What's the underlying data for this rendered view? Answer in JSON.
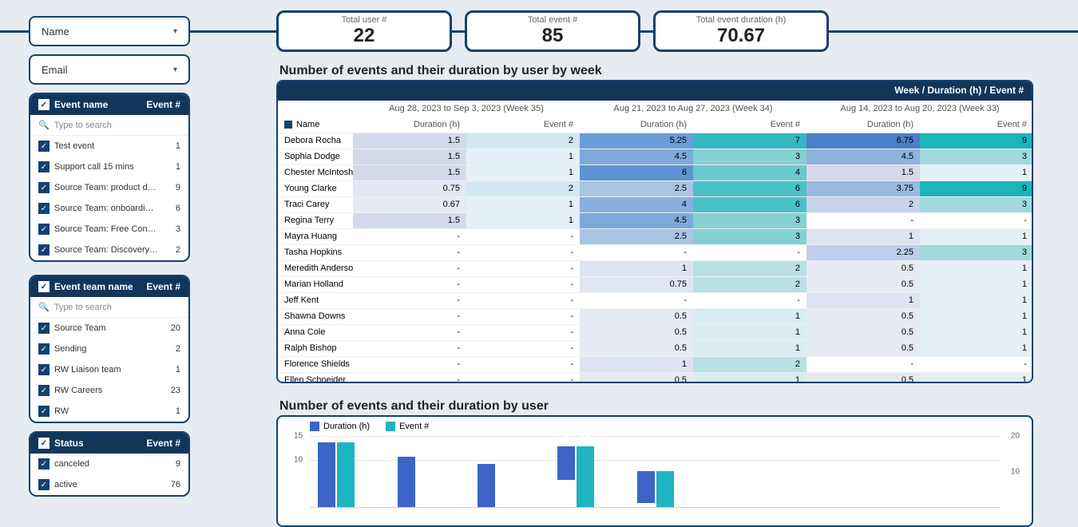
{
  "dropdowns": {
    "name": "Name",
    "email": "Email"
  },
  "kpis": [
    {
      "label": "Total user #",
      "value": "22"
    },
    {
      "label": "Total event #",
      "value": "85"
    },
    {
      "label": "Total event duration (h)",
      "value": "70.67"
    }
  ],
  "filters": {
    "eventName": {
      "title": "Event name",
      "countHeader": "Event #",
      "search": "Type to search",
      "rows": [
        {
          "label": "Test event",
          "count": "1"
        },
        {
          "label": "Support call 15 mins",
          "count": "1"
        },
        {
          "label": "Source Team: product d…",
          "count": "9"
        },
        {
          "label": "Source Team: onboardi…",
          "count": "6"
        },
        {
          "label": "Source Team: Free Cons…",
          "count": "3"
        },
        {
          "label": "Source Team: Discovery…",
          "count": "2"
        }
      ]
    },
    "eventTeam": {
      "title": "Event team name",
      "countHeader": "Event #",
      "search": "Type to search",
      "rows": [
        {
          "label": "Source Team",
          "count": "20"
        },
        {
          "label": "Sending",
          "count": "2"
        },
        {
          "label": "RW Liaison team",
          "count": "1"
        },
        {
          "label": "RW Careers",
          "count": "23"
        },
        {
          "label": "RW",
          "count": "1"
        }
      ]
    },
    "status": {
      "title": "Status",
      "countHeader": "Event #",
      "rows": [
        {
          "label": "canceled",
          "count": "9"
        },
        {
          "label": "active",
          "count": "76"
        }
      ]
    }
  },
  "tableTitle": "Number of events and their duration by user by week",
  "tableTopHeader": "Week / Duration (h) / Event #",
  "weeks": [
    "Aug 28, 2023 to Sep 3, 2023 (Week 35)",
    "Aug 21, 2023 to Aug 27, 2023 (Week 34)",
    "Aug 14, 2023 to Aug 20, 2023 (Week 33)"
  ],
  "colHeaders": {
    "name": "Name",
    "duration": "Duration (h)",
    "event": "Event #"
  },
  "rows": [
    {
      "name": "Debora Rocha",
      "cells": [
        "1.5",
        "2",
        "5.25",
        "7",
        "6.75",
        "9"
      ],
      "bg": [
        "#D4DAEB",
        "#D2E8F0",
        "#6A9DD7",
        "#33B8BF",
        "#4C7FCB",
        "#1CB5BC"
      ]
    },
    {
      "name": "Sophia Dodge",
      "cells": [
        "1.5",
        "1",
        "4.5",
        "3",
        "4.5",
        "3"
      ],
      "bg": [
        "#D4DAEB",
        "#E4F0F5",
        "#7EA8DA",
        "#84D0D3",
        "#8EB3DE",
        "#9FD9DB"
      ]
    },
    {
      "name": "Chester McIntosh",
      "cells": [
        "1.5",
        "1",
        "6",
        "4",
        "1.5",
        "1"
      ],
      "bg": [
        "#D4DAEB",
        "#E4F0F5",
        "#5F93D2",
        "#6AC8CC",
        "#D4DAEB",
        "#E4F0F5"
      ]
    },
    {
      "name": "Young Clarke",
      "cells": [
        "0.75",
        "2",
        "2.5",
        "6",
        "3.75",
        "9"
      ],
      "bg": [
        "#E3E7F2",
        "#D2E8F0",
        "#A9C4E5",
        "#4BC0C5",
        "#99BAE1",
        "#1CB5BC"
      ]
    },
    {
      "name": "Traci Carey",
      "cells": [
        "0.67",
        "1",
        "4",
        "6",
        "2",
        "3"
      ],
      "bg": [
        "#E6EAF3",
        "#E4F0F5",
        "#8AAEDD",
        "#4BC0C5",
        "#C7D3EA",
        "#9FD9DB"
      ]
    },
    {
      "name": "Regina Terry",
      "cells": [
        "1.5",
        "1",
        "4.5",
        "3",
        "-",
        "-"
      ],
      "bg": [
        "#D4DAEB",
        "#E4F0F5",
        "#7EA8DA",
        "#84D0D3",
        "",
        ""
      ]
    },
    {
      "name": "Mayra Huang",
      "cells": [
        "-",
        "-",
        "2.5",
        "3",
        "1",
        "1"
      ],
      "bg": [
        "",
        "",
        "#A9C4E5",
        "#84D0D3",
        "#DDE3F0",
        "#E4F0F5"
      ]
    },
    {
      "name": "Tasha Hopkins",
      "cells": [
        "-",
        "-",
        "-",
        "-",
        "2.25",
        "3"
      ],
      "bg": [
        "",
        "",
        "",
        "",
        "#BECDE8",
        "#9FD9DB"
      ]
    },
    {
      "name": "Meredith Anderson",
      "cells": [
        "-",
        "-",
        "1",
        "2",
        "0.5",
        "1"
      ],
      "bg": [
        "",
        "",
        "#DDE3F0",
        "#B8E1E3",
        "#E6EAF3",
        "#E4F0F5"
      ]
    },
    {
      "name": "Marian Holland",
      "cells": [
        "-",
        "-",
        "0.75",
        "2",
        "0.5",
        "1"
      ],
      "bg": [
        "",
        "",
        "#E0E6F1",
        "#B8E1E3",
        "#E6EAF3",
        "#E4F0F5"
      ]
    },
    {
      "name": "Jeff Kent",
      "cells": [
        "-",
        "-",
        "-",
        "-",
        "1",
        "1"
      ],
      "bg": [
        "",
        "",
        "",
        "",
        "#DDE3F0",
        "#E4F0F5"
      ]
    },
    {
      "name": "Shawna Downs",
      "cells": [
        "-",
        "-",
        "0.5",
        "1",
        "0.5",
        "1"
      ],
      "bg": [
        "",
        "",
        "#E6EAF3",
        "#D8EDF1",
        "#E6EAF3",
        "#E4F0F5"
      ]
    },
    {
      "name": "Anna Cole",
      "cells": [
        "-",
        "-",
        "0.5",
        "1",
        "0.5",
        "1"
      ],
      "bg": [
        "",
        "",
        "#E6EAF3",
        "#D8EDF1",
        "#E6EAF3",
        "#E4F0F5"
      ]
    },
    {
      "name": "Ralph Bishop",
      "cells": [
        "-",
        "-",
        "0.5",
        "1",
        "0.5",
        "1"
      ],
      "bg": [
        "",
        "",
        "#E6EAF3",
        "#D8EDF1",
        "#E6EAF3",
        "#E4F0F5"
      ]
    },
    {
      "name": "Florence Shields",
      "cells": [
        "-",
        "-",
        "1",
        "2",
        "-",
        "-"
      ],
      "bg": [
        "",
        "",
        "#DDE3F0",
        "#B8E1E3",
        "",
        ""
      ]
    },
    {
      "name": "Ellen Schneider",
      "cells": [
        "-",
        "-",
        "0.5",
        "1",
        "0.5",
        "1"
      ],
      "bg": [
        "",
        "",
        "#E6EAF3",
        "#D8EDF1",
        "#E6EAF3",
        "#E4F0F5"
      ]
    }
  ],
  "chartTitle": "Number of events and their duration by user",
  "chartLegend": {
    "duration": "Duration (h)",
    "event": "Event #"
  },
  "chart_data": {
    "type": "bar",
    "series": [
      {
        "name": "Duration (h)",
        "values": [
          13.5,
          10.5,
          9,
          7,
          6.67
        ],
        "color": "#3D64C7"
      },
      {
        "name": "Event #",
        "values": [
          18,
          null,
          null,
          17,
          10
        ],
        "color": "#1FB4C2"
      }
    ],
    "yticks_left": [
      "10",
      "15"
    ],
    "yticks_right": [
      "10",
      "20"
    ]
  }
}
